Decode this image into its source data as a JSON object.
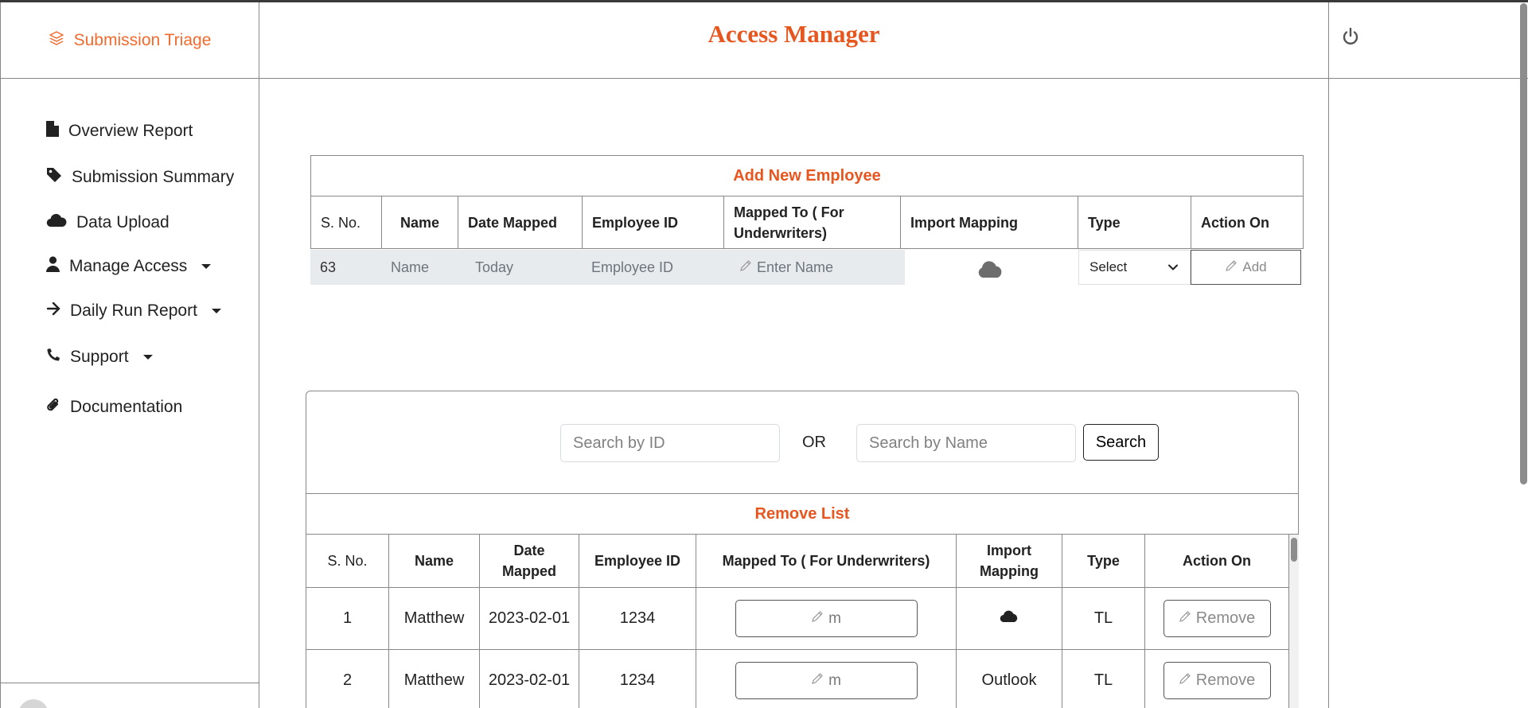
{
  "app": {
    "brand": "Submission Triage",
    "title": "Access Manager"
  },
  "colors": {
    "accent": "#e8561f",
    "brand": "#f26a2e"
  },
  "sidebar": {
    "items": [
      {
        "label": "Overview Report",
        "icon": "file-icon",
        "dropdown": false
      },
      {
        "label": "Submission Summary",
        "icon": "tag-icon",
        "dropdown": false
      },
      {
        "label": "Data Upload",
        "icon": "cloud-icon",
        "dropdown": false
      },
      {
        "label": "Manage Access",
        "icon": "user-icon",
        "dropdown": true
      },
      {
        "label": "Daily Run Report",
        "icon": "arrow-right-icon",
        "dropdown": true
      },
      {
        "label": "Support",
        "icon": "phone-icon",
        "dropdown": true
      },
      {
        "label": "Documentation",
        "icon": "paperclip-icon",
        "dropdown": false
      }
    ]
  },
  "add_employee": {
    "title": "Add New Employee",
    "headers": [
      "S. No.",
      "Name",
      "Date Mapped",
      "Employee ID",
      "Mapped To ( For Underwriters)",
      "Import Mapping",
      "Type",
      "Action On"
    ],
    "row": {
      "sno": "63",
      "name": "Name",
      "date": "Today",
      "employee_id": "Employee ID",
      "mapped_placeholder": "Enter Name",
      "import_icon": "cloud-icon",
      "type_value": "Select",
      "action": "Add"
    }
  },
  "search": {
    "id_placeholder": "Search by ID",
    "or": "OR",
    "name_placeholder": "Search by Name",
    "button": "Search"
  },
  "remove_list": {
    "title": "Remove List",
    "headers": [
      "S. No.",
      "Name",
      "Date Mapped",
      "Employee ID",
      "Mapped To ( For Underwriters)",
      "Import Mapping",
      "Type",
      "Action On"
    ],
    "rows": [
      {
        "sno": "1",
        "name": "Matthew",
        "date": "2023-02-01",
        "employee_id": "1234",
        "mapped": "m",
        "import": "",
        "import_icon": "cloud-icon",
        "type": "TL",
        "action": "Remove"
      },
      {
        "sno": "2",
        "name": "Matthew",
        "date": "2023-02-01",
        "employee_id": "1234",
        "mapped": "m",
        "import": "Outlook",
        "import_icon": "",
        "type": "TL",
        "action": "Remove"
      }
    ]
  }
}
